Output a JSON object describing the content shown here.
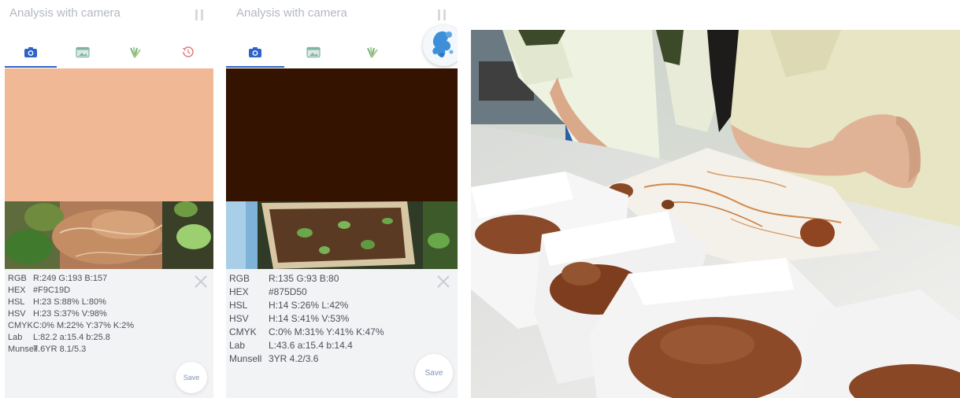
{
  "panels": [
    {
      "app_title": "Analysis with camera",
      "swatch_color": "#F9C19D",
      "close_icon": "close-icon",
      "rows": [
        {
          "key": "RGB",
          "value": "R:249  G:193  B:157"
        },
        {
          "key": "HEX",
          "value": "#F9C19D"
        },
        {
          "key": "HSL",
          "value": "H:23  S:88%  L:80%"
        },
        {
          "key": "HSV",
          "value": "H:23  S:37%  V:98%"
        },
        {
          "key": "CMYK",
          "value": "C:0%  M:22%  Y:37%  K:2%"
        },
        {
          "key": "Lab",
          "value": "L:82.2  a:15.4  b:25.8"
        },
        {
          "key": "Munsell",
          "value": "7.6YR 8.1/5.3"
        }
      ],
      "save_label": "Save"
    },
    {
      "app_title": "Analysis with camera",
      "swatch_color": "#341300",
      "close_icon": "close-icon",
      "rows": [
        {
          "key": "RGB",
          "value": "R:135  G:93  B:80"
        },
        {
          "key": "HEX",
          "value": "#875D50"
        },
        {
          "key": "HSL",
          "value": "H:14  S:26%  L:42%"
        },
        {
          "key": "HSV",
          "value": "H:14  S:41%  V:53%"
        },
        {
          "key": "CMYK",
          "value": "C:0%  M:31%  Y:41%  K:47%"
        },
        {
          "key": "Lab",
          "value": "L:43.6  a:15.4  b:14.4"
        },
        {
          "key": "Munsell",
          "value": "3YR 4.2/3.6"
        }
      ],
      "save_label": "Save"
    }
  ],
  "tab_icons": [
    "camera-icon",
    "image-icon",
    "leaf-icon",
    "history-icon"
  ],
  "colors": {
    "accent": "#2f63c8",
    "title_gray": "#b3b8c2",
    "info_bg": "#f2f3f5"
  }
}
